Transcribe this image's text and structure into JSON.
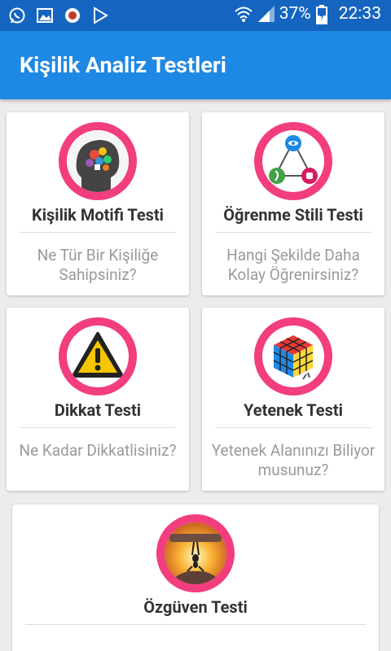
{
  "status_bar": {
    "battery": "37%",
    "time": "22:33",
    "icons": [
      "whatsapp-icon",
      "gallery-icon",
      "app-icon",
      "play-store-icon",
      "wifi-icon",
      "signal-icon",
      "battery-icon"
    ]
  },
  "app_bar": {
    "title": "Kişilik Analiz Testleri"
  },
  "cards": [
    {
      "title": "Kişilik Motifi Testi",
      "subtitle": "Ne Tür Bir Kişiliğe Sahipsiniz?",
      "icon": "puzzle-head-icon"
    },
    {
      "title": "Öğrenme Stili Testi",
      "subtitle": "Hangi Şekilde Daha Kolay Öğrenirsiniz?",
      "icon": "learning-triangle-icon"
    },
    {
      "title": "Dikkat Testi",
      "subtitle": "Ne Kadar Dikkatlisiniz?",
      "icon": "warning-icon"
    },
    {
      "title": "Yetenek Testi",
      "subtitle": "Yetenek Alanınızı Biliyor musunuz?",
      "icon": "rubiks-cube-icon"
    },
    {
      "title": "Özgüven Testi",
      "subtitle": "",
      "icon": "ant-lifting-icon"
    }
  ],
  "colors": {
    "status_bar": "#1565c0",
    "app_bar": "#1e88e5",
    "icon_ring": "#f23d7e",
    "background": "#ececec"
  }
}
